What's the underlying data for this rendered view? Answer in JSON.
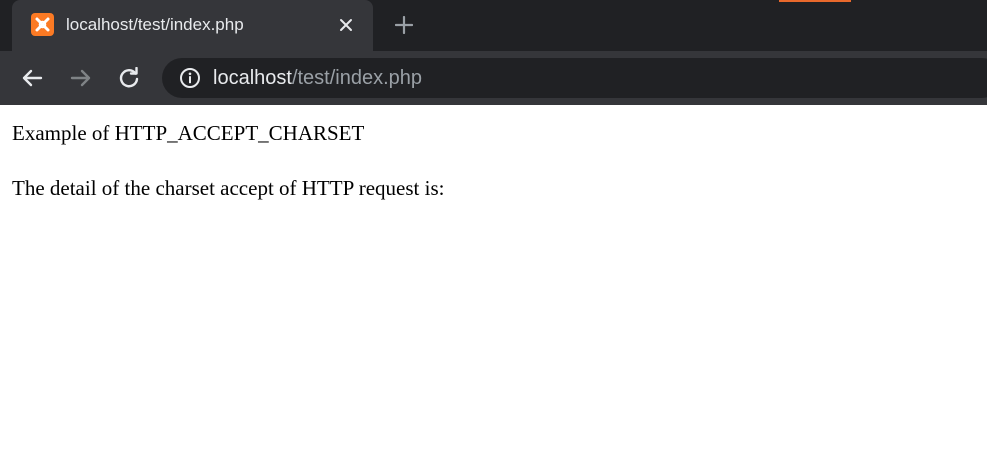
{
  "browser": {
    "tab": {
      "title": "localhost/test/index.php",
      "favicon": "xampp-icon",
      "close_icon": "close-icon"
    },
    "new_tab_icon": "plus-icon",
    "nav": {
      "back_icon": "back-arrow-icon",
      "forward_icon": "forward-arrow-icon",
      "reload_icon": "reload-icon"
    },
    "address_bar": {
      "info_icon": "info-icon",
      "host": "localhost",
      "path": "/test/index.php"
    },
    "colors": {
      "tabstrip": "#202124",
      "active_tab": "#35363a",
      "omnibox": "#202124",
      "favicon": "#fb7a24",
      "accent": "#e8692c"
    }
  },
  "page": {
    "line1": "Example of HTTP_ACCEPT_CHARSET",
    "line2": "The detail of the charset accept of HTTP request is:"
  }
}
